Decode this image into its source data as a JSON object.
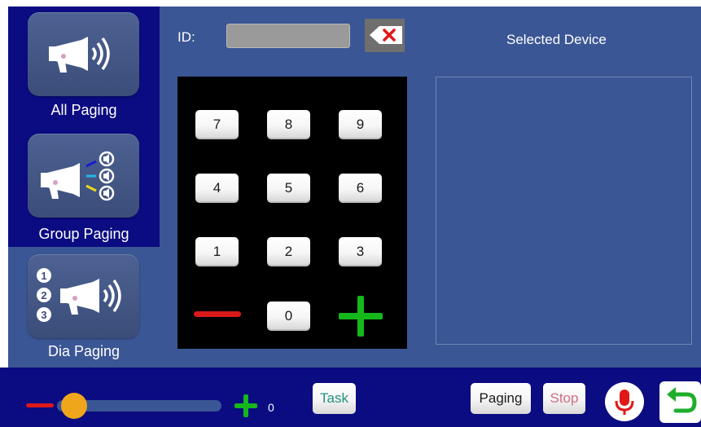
{
  "sidebar": {
    "items": [
      {
        "label": "All Paging",
        "icon": "megaphone-waves-icon",
        "active": false
      },
      {
        "label": "Group Paging",
        "icon": "megaphone-group-speakers-icon",
        "active": false
      },
      {
        "label": "Dia Paging",
        "icon": "megaphone-numbered-icon",
        "active": true
      }
    ]
  },
  "header": {
    "id_label": "ID:",
    "id_value": "",
    "backspace_icon": "backspace-icon",
    "selected_title": "Selected Device"
  },
  "keypad": {
    "keys": [
      "7",
      "8",
      "9",
      "4",
      "5",
      "6",
      "1",
      "2",
      "3",
      "0"
    ],
    "minus_icon": "minus-icon",
    "plus_icon": "plus-icon"
  },
  "bottom_bar": {
    "volume_value": "0",
    "volume_level": 0,
    "task_label": "Task",
    "paging_label": "Paging",
    "stop_label": "Stop",
    "mic_icon": "microphone-icon",
    "back_icon": "back-arrow-icon"
  },
  "colors": {
    "sidebar_bg": "#0b0b82",
    "main_bg": "#3b5694",
    "minus_red": "#d91a1a",
    "plus_green": "#15b81b",
    "slider_knob": "#f0a61a"
  }
}
